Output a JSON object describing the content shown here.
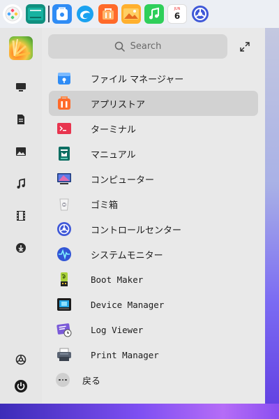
{
  "search": {
    "placeholder": "Search"
  },
  "dock": {
    "icons": [
      "launcher-icon",
      "file-manager-icon",
      "app-store-icon",
      "browser-icon",
      "store-bag-icon",
      "image-viewer-icon",
      "music-icon",
      "calendar-icon",
      "control-center-icon"
    ],
    "calendar": {
      "month": "JUN",
      "day": "6"
    }
  },
  "sidebar": {
    "items": [
      {
        "icon": "computer-icon"
      },
      {
        "icon": "document-icon"
      },
      {
        "icon": "picture-icon"
      },
      {
        "icon": "music-note-icon"
      },
      {
        "icon": "video-icon"
      },
      {
        "icon": "download-icon"
      }
    ],
    "bottom": [
      {
        "icon": "settings-icon"
      },
      {
        "icon": "power-icon"
      }
    ]
  },
  "apps": [
    {
      "label": "ファイル マネージャー",
      "icon": "file-manager-icon",
      "selected": false
    },
    {
      "label": "アプリストア",
      "icon": "app-store-icon",
      "selected": true
    },
    {
      "label": "ターミナル",
      "icon": "terminal-icon",
      "selected": false
    },
    {
      "label": "マニュアル",
      "icon": "manual-icon",
      "selected": false
    },
    {
      "label": "コンピューター",
      "icon": "computer-icon",
      "selected": false
    },
    {
      "label": "ゴミ箱",
      "icon": "trash-icon",
      "selected": false
    },
    {
      "label": "コントロールセンター",
      "icon": "control-center-icon",
      "selected": false
    },
    {
      "label": "システムモニター",
      "icon": "system-monitor-icon",
      "selected": false
    },
    {
      "label": "Boot Maker",
      "icon": "boot-maker-icon",
      "selected": false
    },
    {
      "label": "Device Manager",
      "icon": "device-manager-icon",
      "selected": false
    },
    {
      "label": "Log Viewer",
      "icon": "log-viewer-icon",
      "selected": false
    },
    {
      "label": "Print Manager",
      "icon": "printer-icon",
      "selected": false
    }
  ],
  "back": {
    "label": "戻る"
  },
  "colors": {
    "selected_row": "#d2d2d2",
    "panel_bg": "#e9e9e9",
    "dock_bg": "#eceff4"
  }
}
